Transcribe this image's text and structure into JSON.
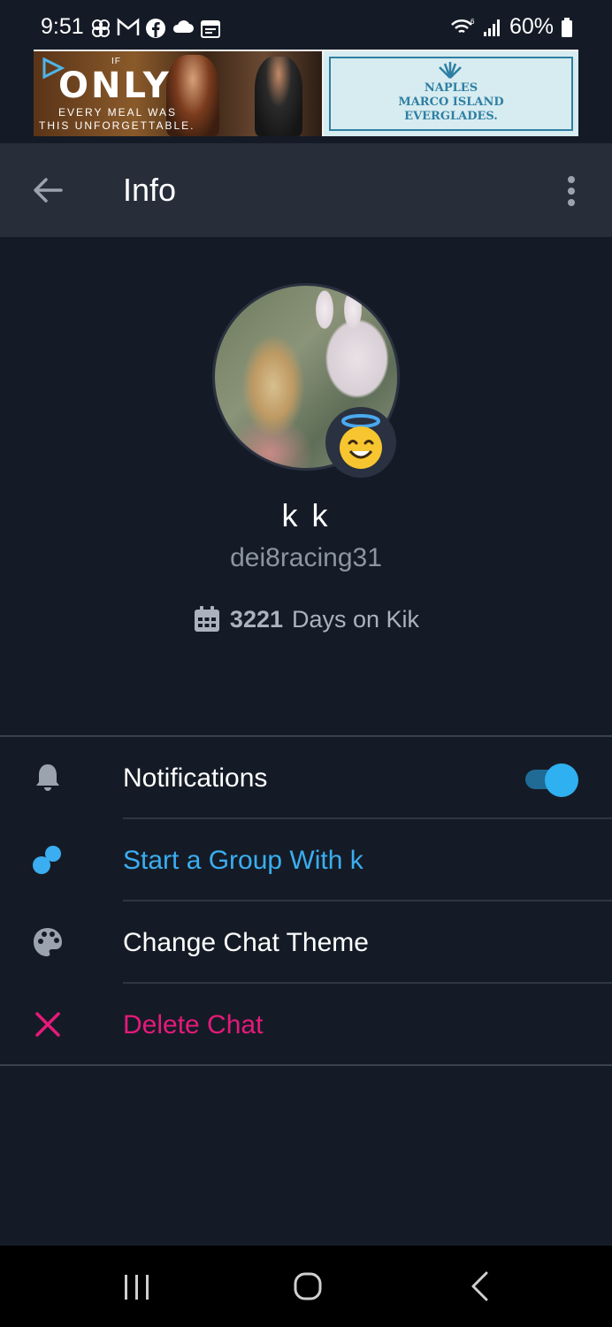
{
  "status_bar": {
    "time": "9:51",
    "battery_percent": "60%",
    "left_icons": [
      "pinwheel-icon",
      "gmail-icon",
      "facebook-icon",
      "cloud-icon",
      "calendar-icon"
    ],
    "right_icons": [
      "wifi-icon",
      "signal-icon",
      "battery-icon"
    ]
  },
  "ad": {
    "left": {
      "if_text": "IF",
      "headline": "ONLY",
      "tagline_1": "EVERY MEAL WAS",
      "tagline_2": "THIS UNFORGETTABLE."
    },
    "right": {
      "line_1": "NAPLES",
      "line_2": "MARCO ISLAND",
      "line_3": "EVERGLADES."
    }
  },
  "app_bar": {
    "title": "Info",
    "back_icon": "arrow-left-icon",
    "menu_icon": "more-vertical-icon"
  },
  "profile": {
    "display_name": "k k",
    "username": "dei8racing31",
    "days_count": "3221",
    "days_label": "Days on Kik",
    "badge_emoji": "smiling-face-with-halo"
  },
  "menu": {
    "notifications": {
      "label": "Notifications",
      "enabled": true
    },
    "start_group": {
      "label": "Start a Group With k"
    },
    "change_theme": {
      "label": "Change Chat Theme"
    },
    "delete_chat": {
      "label": "Delete Chat"
    }
  },
  "colors": {
    "background": "#151b26",
    "app_bar": "#272e39",
    "accent_blue": "#3aaef0",
    "delete_pink": "#e6197a",
    "muted_text": "#8c95a2"
  }
}
